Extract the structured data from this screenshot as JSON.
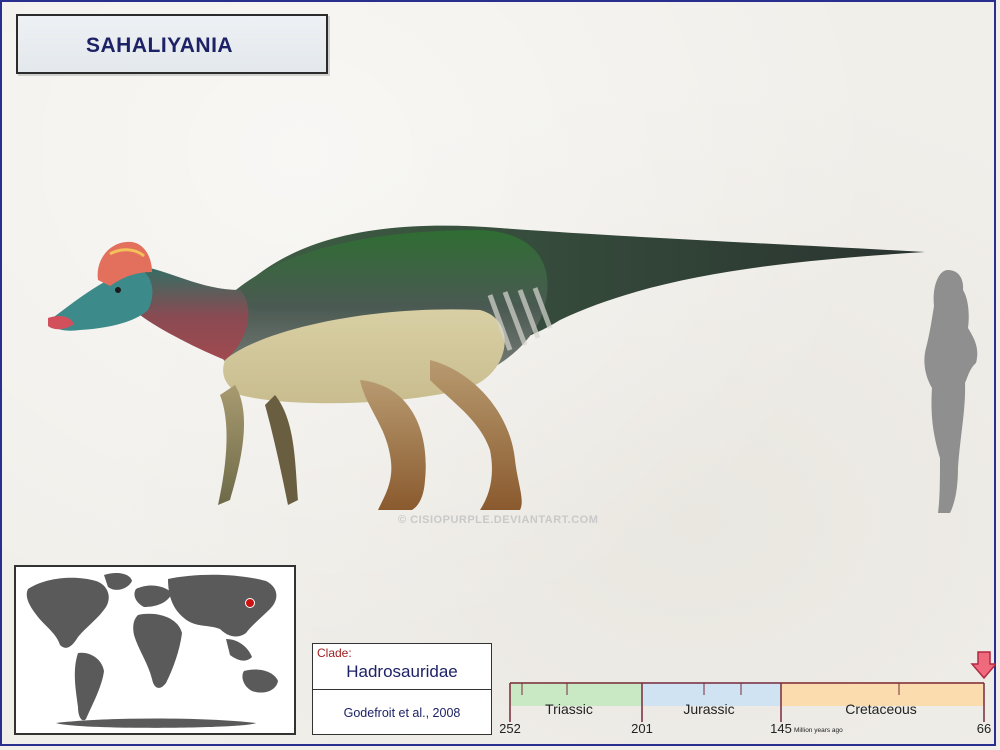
{
  "title": "SAHALIYANIA",
  "watermark": "© CISIOPURPLE.DEVIANTART.COM",
  "map": {
    "location_marker_color": "#cc1111"
  },
  "clade": {
    "label": "Clade:",
    "name": "Hadrosauridae",
    "authority": "Godefroit et al., 2008"
  },
  "timeline": {
    "periods": [
      "Triassic",
      "Jurassic",
      "Cretaceous"
    ],
    "ticks": [
      "252",
      "201",
      "145",
      "66"
    ],
    "unit_label": "Million years ago",
    "period_colors": {
      "triassic": "#c9e8c4",
      "jurassic": "#cfe3f2",
      "cretaceous": "#fbdcae"
    },
    "marker_color": "#f06a7e"
  },
  "colors": {
    "frame": "#2a2f8f",
    "title_text": "#1d2266"
  }
}
